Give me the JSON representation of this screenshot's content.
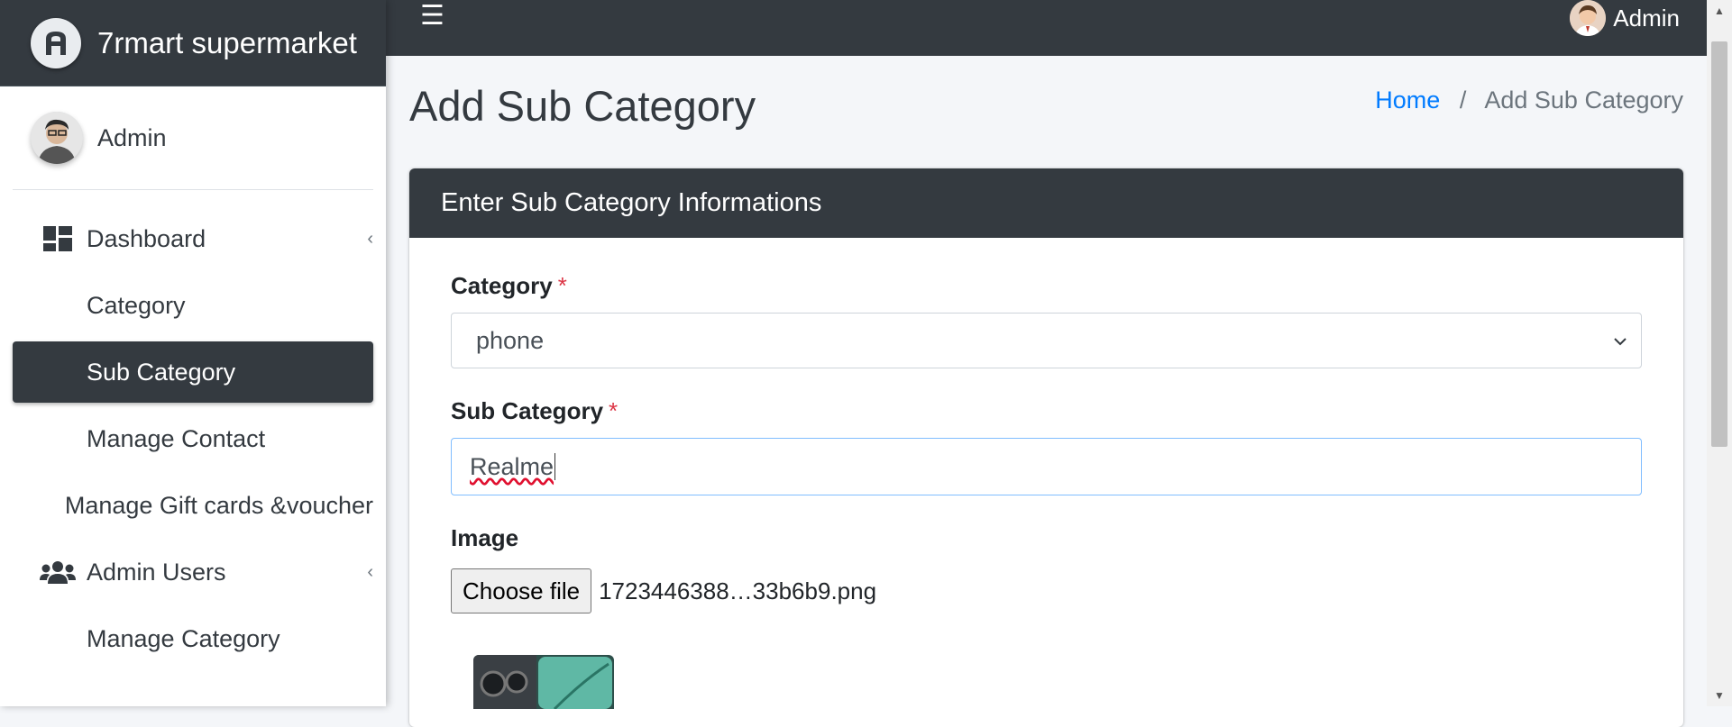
{
  "brand": {
    "name": "7rmart supermarket"
  },
  "user": {
    "name": "Admin"
  },
  "sidebar": {
    "items": [
      {
        "label": "Dashboard",
        "icon": "dashboard-icon",
        "has_arrow": true
      },
      {
        "label": "Category"
      },
      {
        "label": "Sub Category",
        "active": true
      },
      {
        "label": "Manage Contact"
      },
      {
        "label": "Manage Gift cards &voucher"
      },
      {
        "label": "Admin Users",
        "icon": "users-icon",
        "has_arrow": true
      },
      {
        "label": "Manage Category"
      }
    ]
  },
  "topbar": {
    "user_name": "Admin",
    "menu_icon": "hamburger-icon"
  },
  "page": {
    "title": "Add Sub Category",
    "breadcrumb": {
      "home": "Home",
      "separator": "/",
      "current": "Add Sub Category"
    }
  },
  "card": {
    "header": "Enter Sub Category Informations",
    "category": {
      "label": "Category",
      "required_mark": "*",
      "value": "phone"
    },
    "subcategory": {
      "label": "Sub Category",
      "required_mark": "*",
      "value": "Realme"
    },
    "image": {
      "label": "Image",
      "button": "Choose file",
      "file_name": "1723446388…33b6b9.png"
    }
  },
  "colors": {
    "dark": "#343a40",
    "link": "#007bff",
    "required": "#dc3545",
    "focus_border": "#80bdff"
  }
}
